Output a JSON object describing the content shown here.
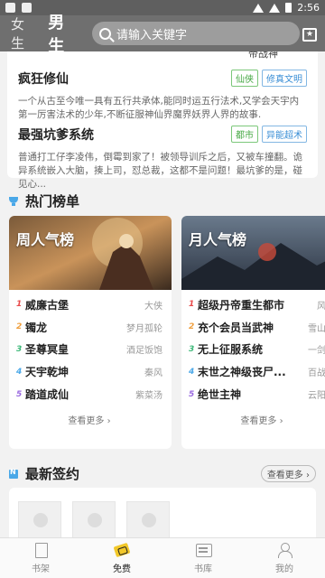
{
  "statusbar": {
    "time": "2:56"
  },
  "topbar": {
    "tabs": [
      {
        "label": "女生"
      },
      {
        "label": "男生"
      }
    ],
    "search_placeholder": "请输入关键字"
  },
  "recommend": {
    "author_tag": "帝战神",
    "books": [
      {
        "title": "疯狂修仙",
        "tags": [
          "仙侠",
          "修真文明"
        ],
        "desc": "一个从古至今唯一具有五行共承体,能同时运五行法术,又学会天宇内第一厉害法术的少年,不断征服神仙界魔界妖界人界的故事."
      },
      {
        "title": "最强坑爹系统",
        "tags": [
          "都市",
          "异能超术"
        ],
        "desc": "普通打工仔李凌伟，倒霉到家了！被领导训斥之后，又被车撞翻。诡异系统嵌入大脑，揍上司，怼总裁，这都不是问题！最坑爹的是，碰见心..."
      }
    ]
  },
  "hot_ranks": {
    "title": "热门榜单",
    "boards": [
      {
        "name": "周人气榜",
        "more": "查看更多",
        "rows": [
          {
            "num": "1",
            "book": "威廉古堡",
            "author": "大侠"
          },
          {
            "num": "2",
            "book": "镯龙",
            "author": "梦月孤轮"
          },
          {
            "num": "3",
            "book": "圣尊冥皇",
            "author": "酒足饭饱"
          },
          {
            "num": "4",
            "book": "天宇乾坤",
            "author": "秦风"
          },
          {
            "num": "5",
            "book": "踏道成仙",
            "author": "紫菜汤"
          }
        ]
      },
      {
        "name": "月人气榜",
        "more": "查看更多",
        "rows": [
          {
            "num": "1",
            "book": "超级丹帝重生都市",
            "author": "风卞"
          },
          {
            "num": "2",
            "book": "充个会员当武神",
            "author": "雪山白"
          },
          {
            "num": "3",
            "book": "无上征服系统",
            "author": "一剑长"
          },
          {
            "num": "4",
            "book": "末世之神级丧尸...",
            "author": "百战穿"
          },
          {
            "num": "5",
            "book": "绝世主神",
            "author": "云阳涛"
          }
        ]
      }
    ]
  },
  "latest": {
    "title": "最新签约",
    "more": "查看更多"
  },
  "bottom_nav": [
    {
      "label": "书架"
    },
    {
      "label": "免费"
    },
    {
      "label": "书库"
    },
    {
      "label": "我的"
    }
  ],
  "colors": {
    "accent": "#4aa8e8",
    "tag_green": "#46a844",
    "tag_blue": "#3b8fd6",
    "nav_active": "#f2c82a"
  }
}
